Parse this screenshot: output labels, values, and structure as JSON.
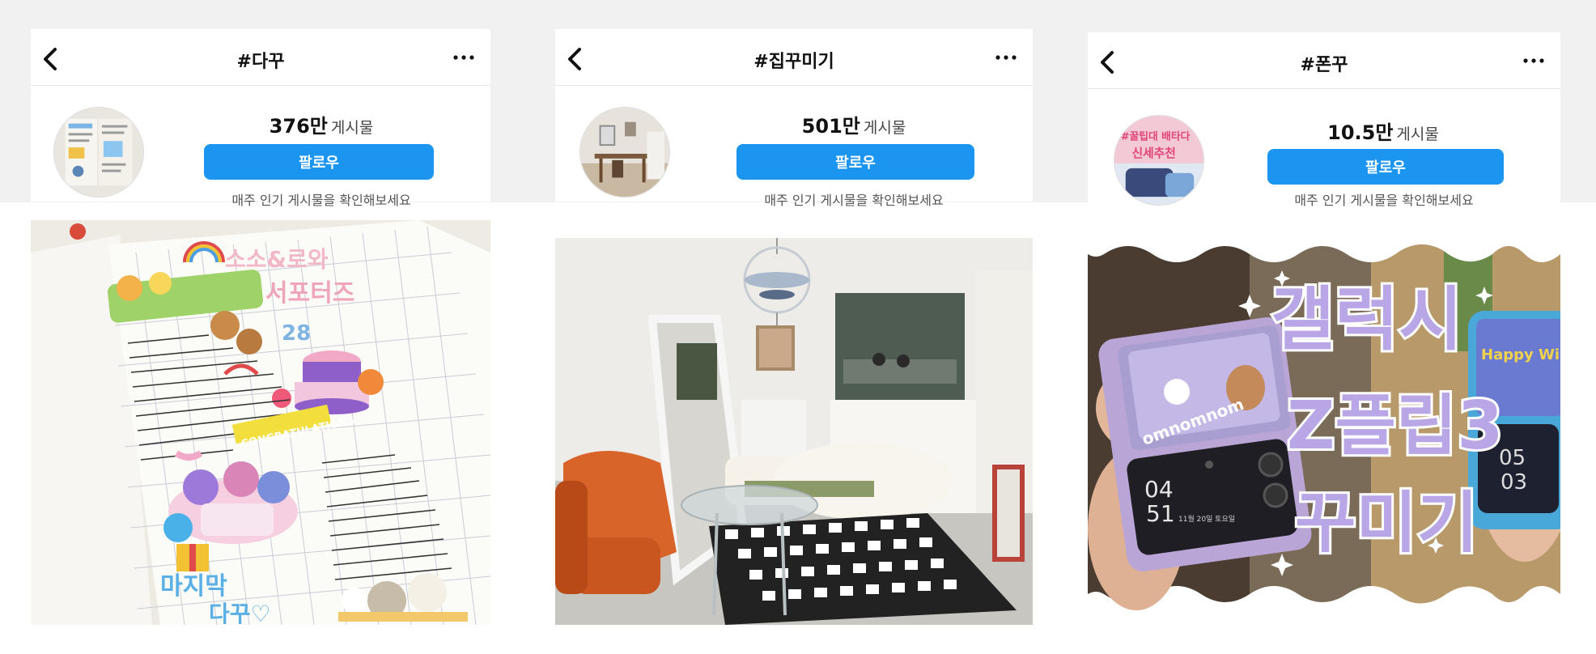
{
  "panels": [
    {
      "title": "#다꾸",
      "count": "376만",
      "count_unit": "게시물",
      "follow_label": "팔로우",
      "hint": "매주 인기 게시물을 확인해보세요",
      "photo": {
        "sticker_text_1": "소소&로와",
        "sticker_text_2": "서포터즈",
        "sticker_number": "28",
        "banner_text": "CONGRATULATIONS",
        "note_text_1": "마지막",
        "note_text_2": "다꾸♡"
      }
    },
    {
      "title": "#집꾸미기",
      "count": "501만",
      "count_unit": "게시물",
      "follow_label": "팔로우",
      "hint": "매주 인기 게시물을 확인해보세요"
    },
    {
      "title": "#폰꾸",
      "count": "10.5만",
      "count_unit": "게시물",
      "follow_label": "팔로우",
      "hint": "매주 인기 게시물을 확인해보세요",
      "avatar_text_1": "#꿀팁대 배타다",
      "avatar_text_2": "신세추천",
      "photo": {
        "overlay_line_1": "갤럭시",
        "overlay_line_2": "Z플립3",
        "overlay_line_3": "꾸미기",
        "case_text": "omnomnom",
        "phone_time_1": "04",
        "phone_time_2": "51",
        "phone_date": "11월 20일 토요일",
        "right_phone_text": "Happy Winter",
        "right_time_1": "05",
        "right_time_2": "03"
      }
    }
  ],
  "colors": {
    "follow_button": "#1b95f0",
    "page_band": "#f1f1f1"
  },
  "icons": {
    "back": "chevron-left-icon",
    "more": "more-horizontal-icon"
  }
}
